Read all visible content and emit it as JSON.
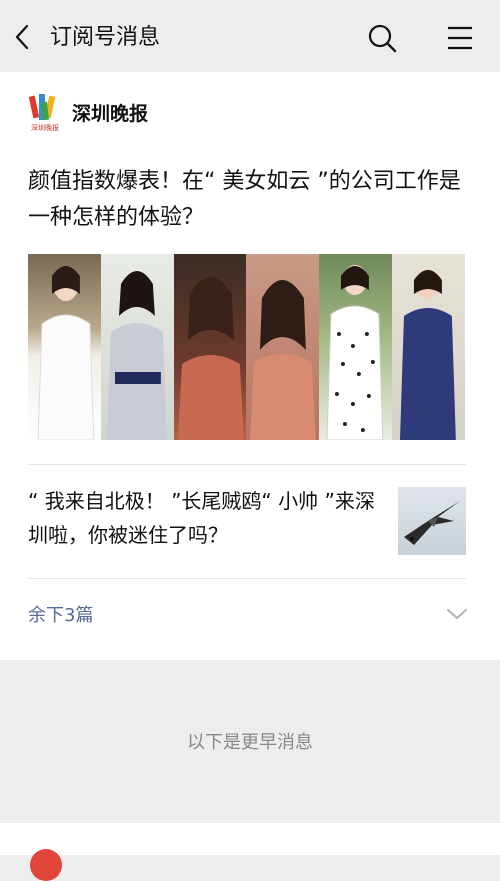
{
  "header": {
    "title": "订阅号消息",
    "back_icon": "chevron-left-icon",
    "search_icon": "search-icon",
    "menu_icon": "menu-icon"
  },
  "publisher": {
    "name": "深圳晚报",
    "logo_text": "深圳晚报"
  },
  "articles": [
    {
      "title": "颜值指数爆表！在“ 美女如云 ”的公司工作是一种怎样的体验？"
    },
    {
      "title": "“ 我来自北极！ ”长尾贼鸥“ 小帅 ”来深圳啦，你被迷住了吗？"
    }
  ],
  "more": {
    "label": "余下3篇",
    "icon": "chevron-down-icon"
  },
  "earlier_notice": "以下是更早消息",
  "colors": {
    "background": "#ededed",
    "card": "#ffffff",
    "link": "#576b95",
    "muted": "#888888"
  }
}
